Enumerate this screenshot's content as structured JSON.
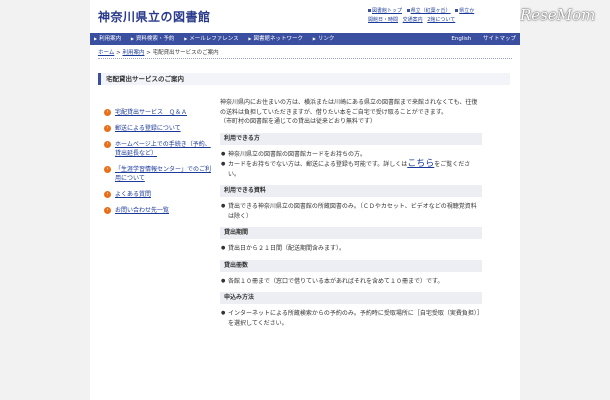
{
  "header": {
    "site_title": "神奈川県立の図書館",
    "utility_links": [
      "図書館トップ",
      "県立（紅葉ヶ丘）",
      "県立か"
    ],
    "utility_links_row2": [
      "開館日・時間",
      "交通案内",
      "2館について"
    ],
    "watermark": "ReseMom"
  },
  "nav": {
    "items": [
      "利用案内",
      "資料検索・予約",
      "メールレファレンス",
      "図書館ネットワーク",
      "リンク"
    ],
    "english": "English",
    "sitemap": "サイトマップ"
  },
  "breadcrumb": {
    "home": "ホーム",
    "sep1": " > ",
    "parent": "利用案内",
    "sep2": " > ",
    "current": "宅配貸出サービスのご案内"
  },
  "page_title": "宅配貸出サービスのご案内",
  "sidebar": {
    "items": [
      {
        "label": "宅配貸出サービス　Ｑ＆Ａ"
      },
      {
        "label": "郵送による登録について"
      },
      {
        "label": "ホームページ上での手続き（予約、貸出延長など）"
      },
      {
        "label": "「生涯学習情報センター」でのご利用について"
      },
      {
        "label": "よくある質問"
      },
      {
        "label": "お問い合わせ先一覧"
      }
    ],
    "bullet_glyph": "›"
  },
  "main": {
    "intro": "神奈川県内にお住まいの方は、横浜または川崎にある県立の図書館まで来館されなくても、往復の送料は負担していただきますが、借りたい本をご自宅で受け取ることができます。",
    "intro_note": "（市町村の図書館を通じての貸出は従来どおり無料です）",
    "sections": {
      "users": {
        "heading": "利用できる方",
        "item1": "神奈川県立の図書館の図書館カードをお持ちの方。",
        "item2_pre": "カードをお持ちでない方は、郵送による登録も可能です。詳しくは",
        "item2_link": "こちら",
        "item2_post": "をご覧ください。"
      },
      "materials": {
        "heading": "利用できる資料",
        "item1": "貸出できる神奈川県立の図書館の所蔵図書のみ。（ＣＤやカセット、ビデオなどの視聴覚資料は除く）"
      },
      "period": {
        "heading": "貸出期間",
        "item1": "貸出日から２１日間（配送期間含みます）。"
      },
      "count": {
        "heading": "貸出冊数",
        "item1": "各館１０冊まで（窓口で借りている本があればそれを含めて１０冊まで）です。"
      },
      "apply": {
        "heading": "申込み方法",
        "item1": "インターネットによる所蔵検索からの予約のみ。予約時に受取場所に［自宅受取（実費負担）］を選択してください。"
      }
    },
    "list_glyph": "●"
  },
  "colors": {
    "brand": "#2a3a8c",
    "nav_bg": "#3a4fa0",
    "bullet": "#e8701a",
    "section_bg": "#eceef3"
  }
}
